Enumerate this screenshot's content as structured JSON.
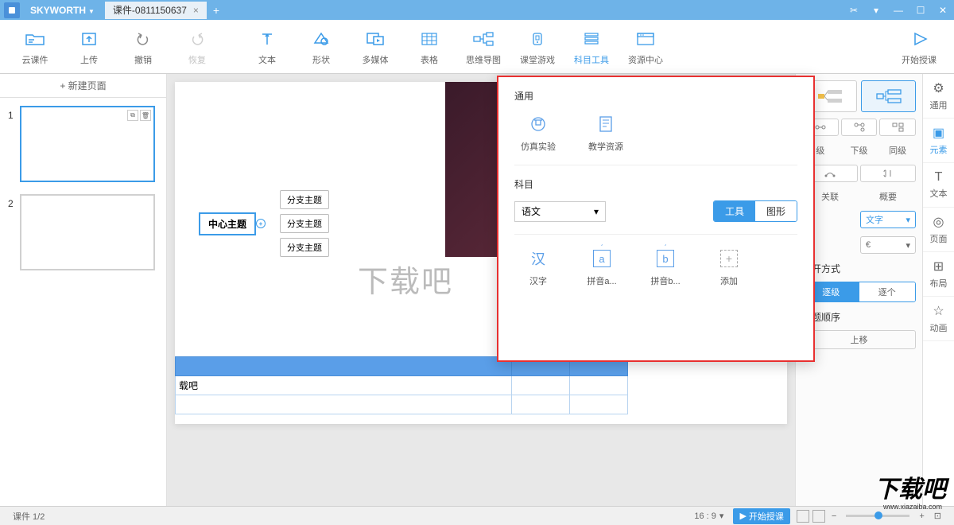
{
  "app": {
    "brand": "SKYWORTH",
    "doc_title": "课件-0811150637"
  },
  "toolbar": {
    "items": [
      {
        "label": "云课件"
      },
      {
        "label": "上传"
      },
      {
        "label": "撤销"
      },
      {
        "label": "恢复"
      },
      {
        "label": "文本"
      },
      {
        "label": "形状"
      },
      {
        "label": "多媒体"
      },
      {
        "label": "表格"
      },
      {
        "label": "思维导图"
      },
      {
        "label": "课堂游戏"
      },
      {
        "label": "科目工具"
      },
      {
        "label": "资源中心"
      },
      {
        "label": "开始授课"
      }
    ]
  },
  "left": {
    "new_page": "+ 新建页面",
    "pages": [
      "1",
      "2"
    ]
  },
  "canvas": {
    "mindmap_center": "中心主题",
    "mindmap_branches": [
      "分支主题",
      "分支主题",
      "分支主题"
    ],
    "watermark": "下载吧",
    "table_cell": "载吧"
  },
  "popup": {
    "general_title": "通用",
    "general_items": [
      {
        "label": "仿真实验"
      },
      {
        "label": "教学资源"
      }
    ],
    "subject_title": "科目",
    "subject_select": "语文",
    "toggle_tool": "工具",
    "toggle_graphic": "图形",
    "tools": [
      {
        "label": "汉字"
      },
      {
        "label": "拼音a..."
      },
      {
        "label": "拼音b..."
      },
      {
        "label": "添加"
      }
    ]
  },
  "right": {
    "sub_labels": [
      "级",
      "下级",
      "同级"
    ],
    "rel_labels": [
      "关联",
      "概要"
    ],
    "text_dropdown": "文字",
    "expand_title": "展开方式",
    "expand_gradual": "逐级",
    "expand_single": "逐个",
    "order_title": "主题顺序",
    "order_up": "上移"
  },
  "right_tabs": [
    {
      "label": "通用"
    },
    {
      "label": "元素"
    },
    {
      "label": "文本"
    },
    {
      "label": "页面"
    },
    {
      "label": "布局"
    },
    {
      "label": "动画"
    }
  ],
  "status": {
    "page_info": "课件 1/2",
    "ratio": "16 : 9",
    "play": "开始授课"
  },
  "watermark_brand": "下载吧",
  "watermark_url": "www.xiazaiba.com"
}
